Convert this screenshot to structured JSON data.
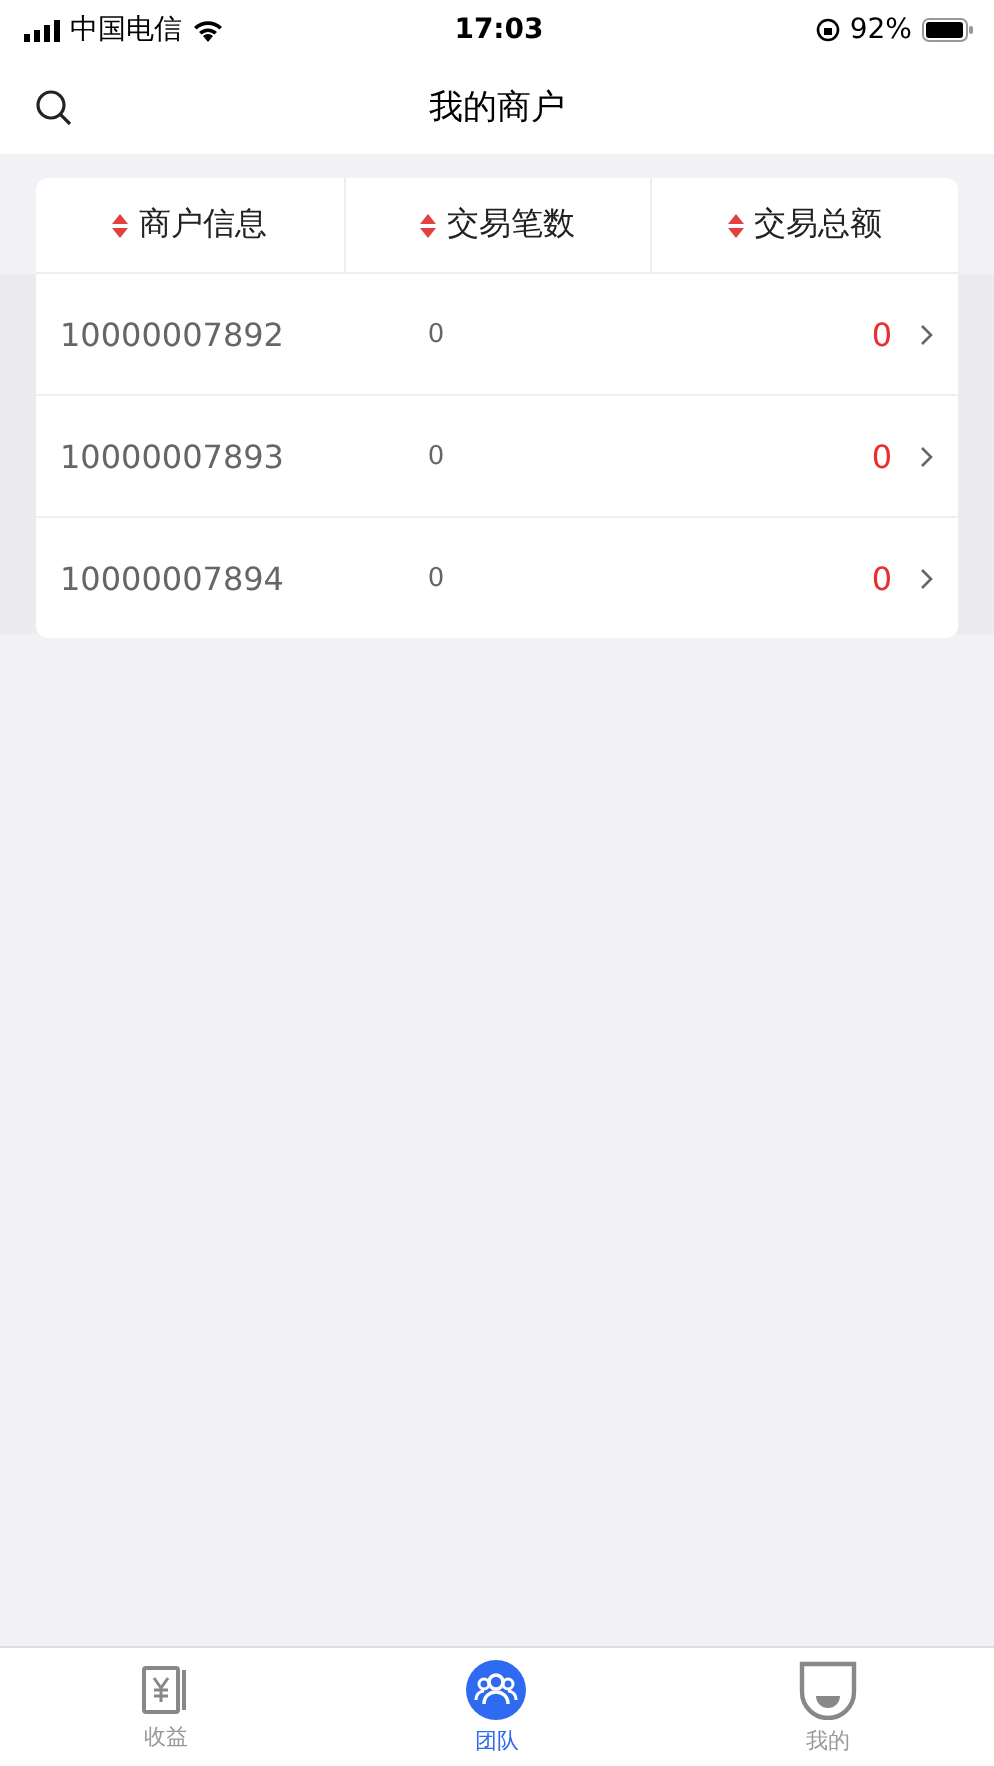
{
  "status_bar": {
    "carrier": "中国电信",
    "time": "17:03",
    "battery": "92%"
  },
  "nav": {
    "title": "我的商户"
  },
  "table": {
    "columns": [
      "商户信息",
      "交易笔数",
      "交易总额"
    ],
    "rows": [
      {
        "merchant": "10000007892",
        "count": "0",
        "amount": "0"
      },
      {
        "merchant": "10000007893",
        "count": "0",
        "amount": "0"
      },
      {
        "merchant": "10000007894",
        "count": "0",
        "amount": "0"
      }
    ]
  },
  "tab_bar": [
    {
      "label": "收益",
      "kind": "income",
      "selected": false
    },
    {
      "label": "团队",
      "kind": "team",
      "selected": true
    },
    {
      "label": "我的",
      "kind": "me",
      "selected": false
    }
  ]
}
